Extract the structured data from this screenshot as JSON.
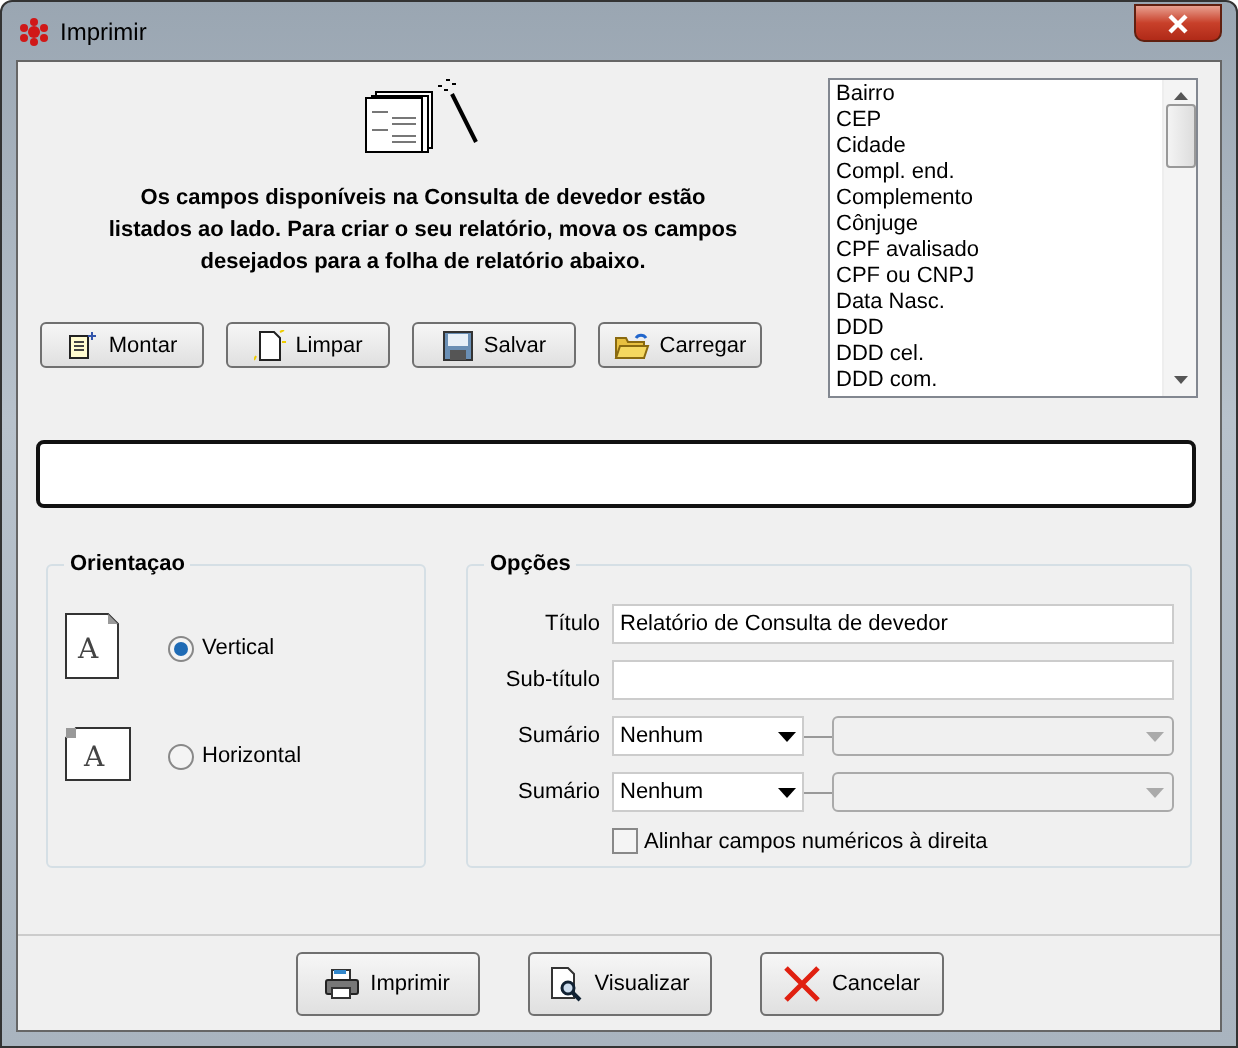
{
  "window": {
    "title": "Imprimir"
  },
  "instructions": "Os campos disponíveis na Consulta de devedor estão listados ao lado. Para criar o seu relatório, mova os campos desejados para a folha de relatório abaixo.",
  "toolbar": [
    {
      "label": "Montar",
      "kind": "wand"
    },
    {
      "label": "Limpar",
      "kind": "new"
    },
    {
      "label": "Salvar",
      "kind": "save"
    },
    {
      "label": "Carregar",
      "kind": "open"
    }
  ],
  "fields": [
    "Bairro",
    "CEP",
    "Cidade",
    "Compl. end.",
    "Complemento",
    "Cônjuge",
    "CPF avalisado",
    "CPF ou CNPJ",
    "Data Nasc.",
    "DDD",
    "DDD cel.",
    "DDD com."
  ],
  "orientation": {
    "title": "Orientaçao",
    "options": [
      {
        "label": "Vertical",
        "kind": "portrait",
        "glyph": "A",
        "selected": true
      },
      {
        "label": "Horizontal",
        "kind": "landscape",
        "glyph": "A",
        "selected": false
      }
    ]
  },
  "options": {
    "title": "Opções",
    "title_field": {
      "label": "Título",
      "value": "Relatório de Consulta de devedor"
    },
    "subtitle_field": {
      "label": "Sub-título"
    },
    "summaries": [
      {
        "label": "Sumário",
        "value": "Nenhum",
        "secondary_disabled": true
      },
      {
        "label": "Sumário",
        "value": "Nenhum",
        "secondary_disabled": true
      }
    ],
    "align_numeric": {
      "label": "Alinhar campos numéricos à direita",
      "checked": false
    }
  },
  "footer": [
    {
      "label": "Imprimir",
      "kind": "print"
    },
    {
      "label": "Visualizar",
      "kind": "preview"
    },
    {
      "label": "Cancelar",
      "kind": "cancel"
    }
  ]
}
